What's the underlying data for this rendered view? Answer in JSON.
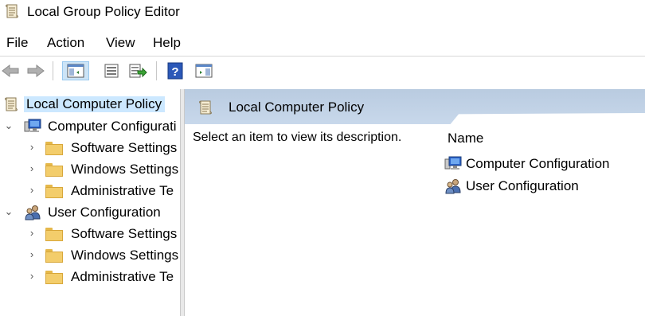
{
  "window": {
    "title": "Local Group Policy Editor",
    "icon": "policy-scroll-icon"
  },
  "menu": [
    "File",
    "Action",
    "View",
    "Help"
  ],
  "toolbar": {
    "buttons": [
      "back-arrow-icon",
      "forward-arrow-icon",
      "show-hide-console-tree-icon",
      "properties-icon",
      "export-list-icon",
      "help-icon",
      "show-hide-action-pane-icon"
    ]
  },
  "tree": {
    "root": "Local Computer Policy",
    "computer": {
      "label": "Computer Configurati",
      "children": [
        "Software Settings",
        "Windows Settings",
        "Administrative Te"
      ]
    },
    "user": {
      "label": "User Configuration",
      "children": [
        "Software Settings",
        "Windows Settings",
        "Administrative Te"
      ]
    }
  },
  "right_pane": {
    "title": "Local Computer Policy",
    "description": "Select an item to view its description.",
    "column_header": "Name",
    "items": [
      "Computer Configuration",
      "User Configuration"
    ]
  },
  "colors": {
    "header_band": "#c1d2e6",
    "selection": "#cce8ff",
    "toolbar_active": "#cce4f7"
  }
}
